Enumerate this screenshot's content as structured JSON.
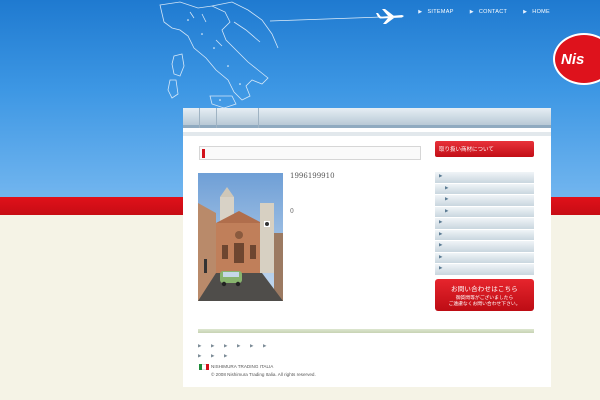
{
  "nav": {
    "sitemap": "SITEMAP",
    "contact": "CONTACT",
    "home": "HOME"
  },
  "logo": {
    "text": "Nis"
  },
  "sidebar": {
    "header": "取り扱い商材について",
    "item_count": 9
  },
  "main": {
    "date": "1996199910",
    "zero": "0"
  },
  "contact": {
    "title": "お問い合わせはこちら",
    "line1": "御質問等がございましたら",
    "line2": "ご遠慮なくお問い合わせ下さい。"
  },
  "footer": {
    "company": "NISHIMURA TRADING ITALIA",
    "copyright": "© 2008 Nishimura Trading Italia. All rights reserved."
  },
  "colors": {
    "sky": "#3d97e4",
    "red": "#d2121b",
    "cream": "#f5f3e6"
  }
}
